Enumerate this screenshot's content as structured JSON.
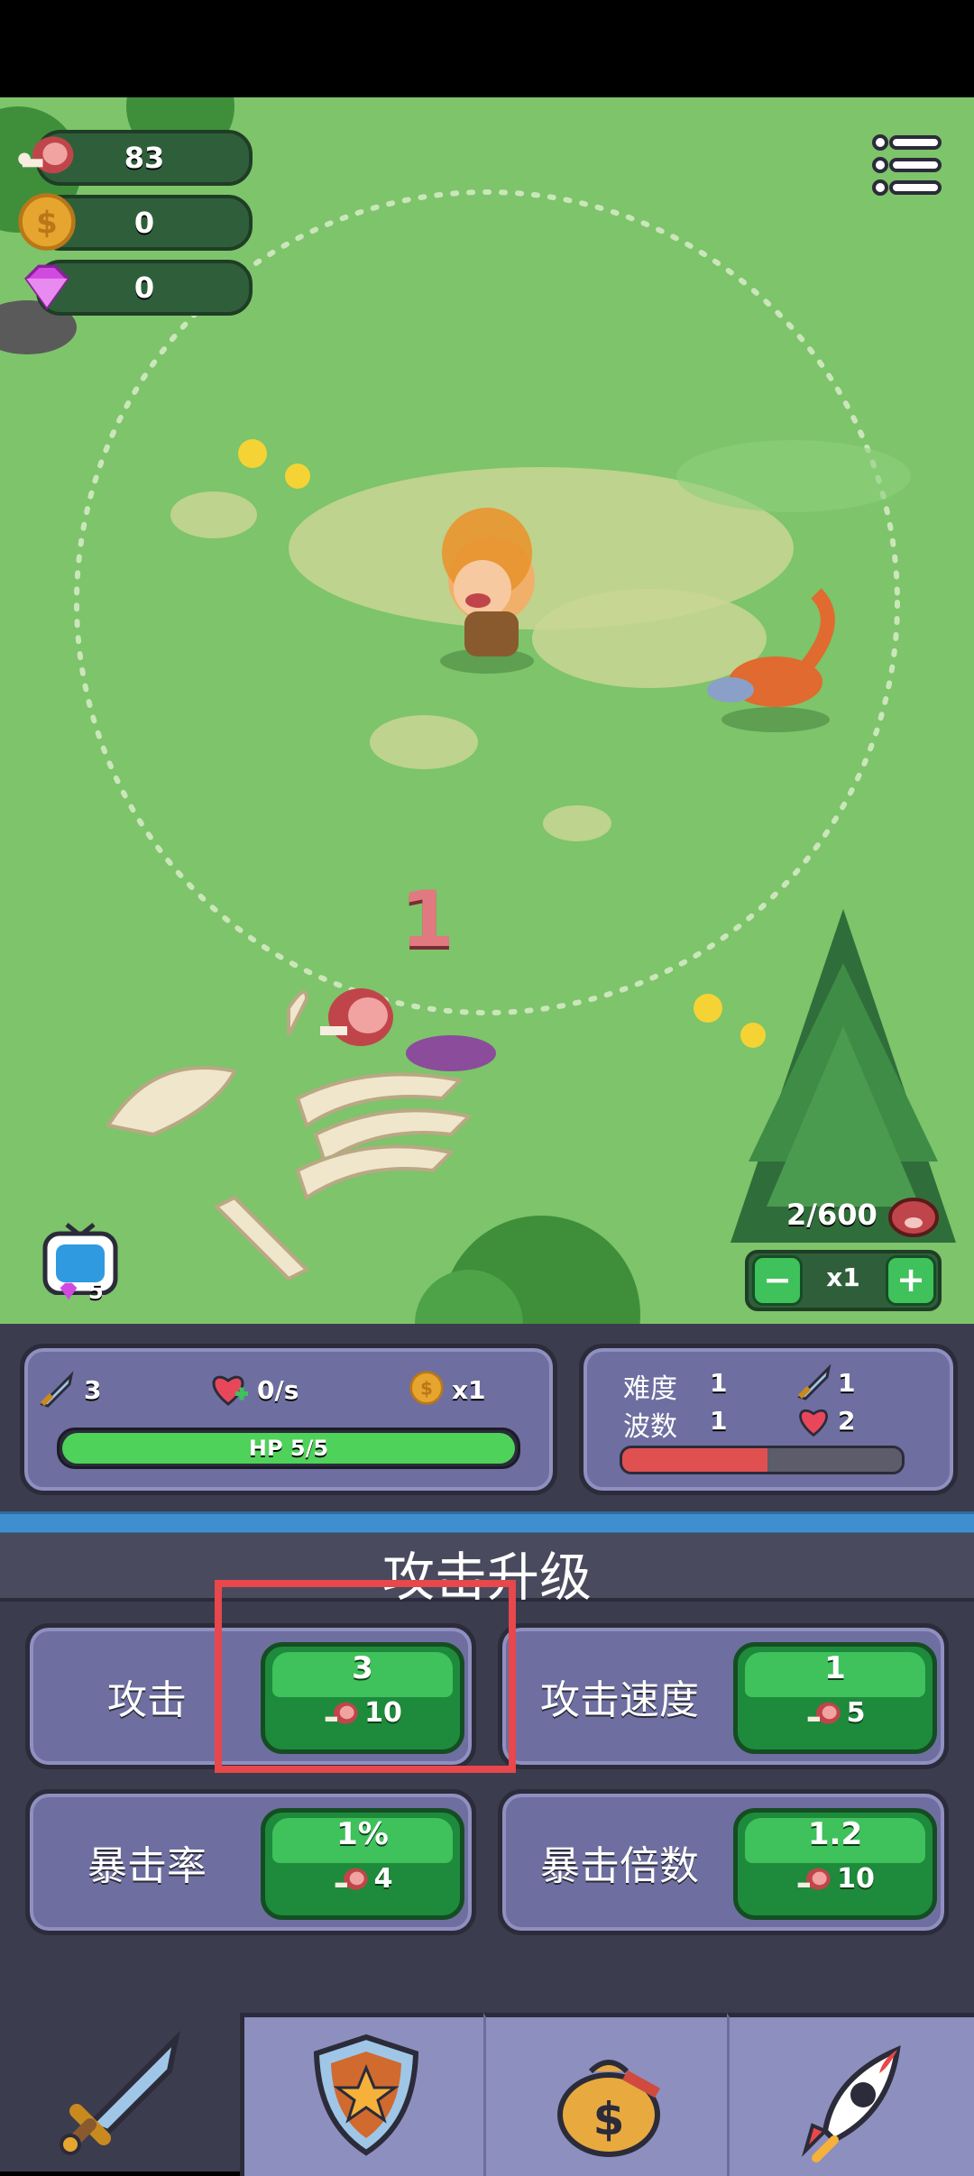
{
  "resources": {
    "meat": "83",
    "coins": "0",
    "gems": "0"
  },
  "field": {
    "damage_popup": "1",
    "kill_counter": "2/600",
    "speed": {
      "minus": "−",
      "label": "x1",
      "plus": "+"
    },
    "tv_gem_count": "5"
  },
  "player_stats": {
    "attack": "3",
    "regen": "0/s",
    "coin_mult": "x1",
    "hp_label": "HP 5/5",
    "hp_fraction": 1.0
  },
  "wave_info": {
    "difficulty_label": "难度",
    "difficulty_value": "1",
    "wave_label": "波数",
    "wave_value": "1",
    "enemy_attack": "1",
    "enemy_hp": "2",
    "wave_progress": 0.52
  },
  "section_title": "攻击升级",
  "upgrades": [
    {
      "label": "攻击",
      "value": "3",
      "cost": "10"
    },
    {
      "label": "攻击速度",
      "value": "1",
      "cost": "5"
    },
    {
      "label": "暴击率",
      "value": "1%",
      "cost": "4"
    },
    {
      "label": "暴击倍数",
      "value": "1.2",
      "cost": "10"
    }
  ],
  "tabs": [
    "sword-icon",
    "shield-star-icon",
    "money-bag-icon",
    "rocket-icon"
  ],
  "colors": {
    "field": "#7dc46a",
    "panel": "#3c3c4f",
    "card": "#6e6fa0",
    "button_green": "#3fc15b",
    "highlight": "#e8474b",
    "hp_bar": "#4fd25a",
    "wave_bar": "#e05050"
  }
}
